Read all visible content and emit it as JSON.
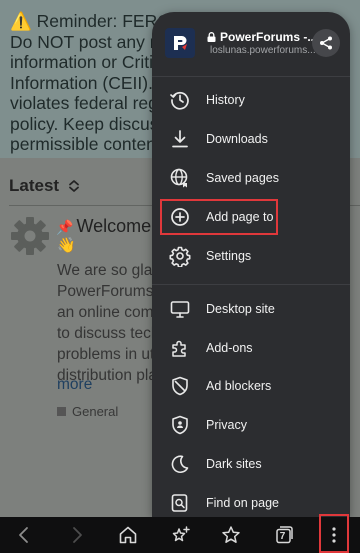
{
  "page": {
    "notice_lines": [
      "⚠️ Reminder: FERC",
      "Do NOT post any no",
      "information or Critic",
      "Information (CEII). S",
      "violates federal regu",
      "policy. Keep discuss",
      "permissible content"
    ],
    "latest_label": "Latest",
    "topic_title": "Welcome to",
    "topic_wave": "👋",
    "topic_body_lines": [
      "We are so glac",
      "PowerForums",
      "an online comr",
      "to discuss tech",
      "problems in ut",
      "distribution pla"
    ],
    "topic_more": "more",
    "category_label": "General"
  },
  "menu": {
    "site_name": "PowerForums -...",
    "site_url": "loslunas.powerforums...",
    "items": [
      {
        "label": "History",
        "icon": "history-icon"
      },
      {
        "label": "Downloads",
        "icon": "download-icon"
      },
      {
        "label": "Saved pages",
        "icon": "globe-icon"
      },
      {
        "label": "Add page to",
        "icon": "plus-circle-icon"
      },
      {
        "label": "Settings",
        "icon": "gear-icon"
      },
      {
        "label": "Desktop site",
        "icon": "monitor-icon"
      },
      {
        "label": "Add-ons",
        "icon": "puzzle-icon"
      },
      {
        "label": "Ad blockers",
        "icon": "shield-block-icon"
      },
      {
        "label": "Privacy",
        "icon": "privacy-icon"
      },
      {
        "label": "Dark sites",
        "icon": "moon-icon"
      },
      {
        "label": "Find on page",
        "icon": "find-icon"
      }
    ]
  },
  "toolbar": {
    "tabs_count": "7",
    "icons": [
      "back-icon",
      "forward-icon",
      "home-icon",
      "bookmark-add-icon",
      "bookmarks-icon",
      "tabs-icon",
      "more-icon"
    ]
  },
  "colors": {
    "menu_bg": "#2c2d30",
    "highlight": "#e0383b",
    "toolbar_bg": "#0f0f10"
  }
}
